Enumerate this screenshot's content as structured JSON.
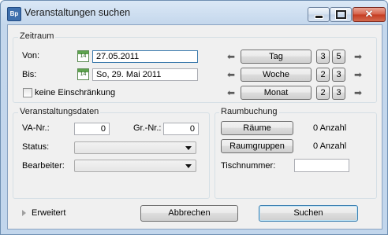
{
  "window": {
    "title": "Veranstaltungen suchen",
    "icon_text": "Bp",
    "close_glyph": "✕"
  },
  "zeitraum": {
    "legend": "Zeitraum",
    "von_label": "Von:",
    "von_value": "27.05.2011",
    "bis_label": "Bis:",
    "bis_value": "So, 29. Mai 2011",
    "calendar_day": "14",
    "no_limit_label": "keine Einschränkung",
    "no_limit_checked": false,
    "steps": [
      {
        "label": "Tag",
        "back": "3",
        "forward": "5"
      },
      {
        "label": "Woche",
        "back": "2",
        "forward": "3"
      },
      {
        "label": "Monat",
        "back": "2",
        "forward": "3"
      }
    ],
    "arrow_glyph": "➡"
  },
  "veranstaltungsdaten": {
    "legend": "Veranstaltungsdaten",
    "va_nr_label": "VA-Nr.:",
    "va_nr_value": "0",
    "gr_nr_label": "Gr.-Nr.:",
    "gr_nr_value": "0",
    "status_label": "Status:",
    "status_value": "",
    "bearbeiter_label": "Bearbeiter:",
    "bearbeiter_value": ""
  },
  "raumbuchung": {
    "legend": "Raumbuchung",
    "raeume_button": "Räume",
    "raeume_count": "0 Anzahl",
    "raumgruppen_button": "Raumgruppen",
    "raumgruppen_count": "0 Anzahl",
    "tischnummer_label": "Tischnummer:",
    "tischnummer_value": ""
  },
  "footer": {
    "erweitert_label": "Erweitert",
    "cancel_label": "Abbrechen",
    "search_label": "Suchen"
  }
}
